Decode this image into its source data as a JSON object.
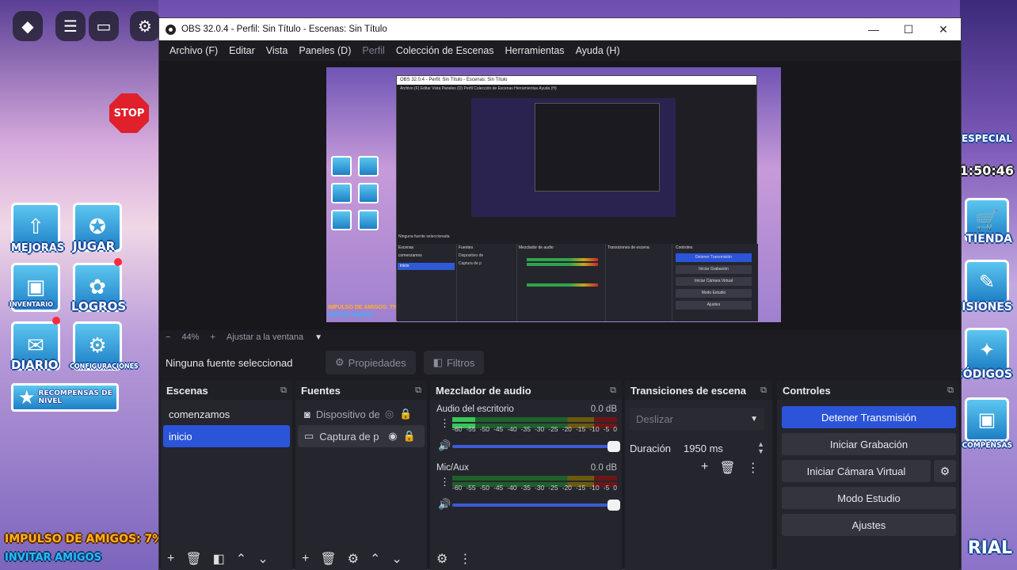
{
  "window": {
    "title": "OBS 32.0.4 - Perfil: Sin Título - Escenas: Sin Título",
    "controls": [
      "—",
      "☐",
      "✕"
    ]
  },
  "menu": [
    {
      "label": "Archivo (F)",
      "enabled": true
    },
    {
      "label": "Editar",
      "enabled": true
    },
    {
      "label": "Vista",
      "enabled": true
    },
    {
      "label": "Paneles (D)",
      "enabled": true
    },
    {
      "label": "Perfil",
      "enabled": false
    },
    {
      "label": "Colección de Escenas",
      "enabled": true
    },
    {
      "label": "Herramientas",
      "enabled": true
    },
    {
      "label": "Ayuda (H)",
      "enabled": true
    }
  ],
  "zoom": {
    "minus": "−",
    "value": "44%",
    "plus": "+",
    "fit": "Ajustar a la ventana",
    "dropdown": "▼"
  },
  "sourcebar": {
    "no_selection": "Ninguna fuente seleccionad",
    "properties": "Propiedades",
    "filters": "Filtros"
  },
  "scenes": {
    "title": "Escenas",
    "items": [
      {
        "label": "comenzamos",
        "selected": false
      },
      {
        "label": "inicio",
        "selected": true
      }
    ]
  },
  "sources": {
    "title": "Fuentes",
    "items": [
      {
        "label": "Dispositivo de",
        "icon": "camera-icon",
        "visible": false
      },
      {
        "label": "Captura de p",
        "icon": "monitor-icon",
        "visible": true
      }
    ]
  },
  "mixer": {
    "title": "Mezclador de audio",
    "channels": [
      {
        "name": "Audio del escritorio",
        "db": "0.0 dB",
        "level": 0.14
      },
      {
        "name": "Mic/Aux",
        "db": "0.0 dB",
        "level": 0.0
      }
    ],
    "ticks": [
      "-60",
      "-55",
      "-50",
      "-45",
      "-40",
      "-35",
      "-30",
      "-25",
      "-20",
      "-15",
      "-10",
      "-5",
      "0"
    ]
  },
  "transitions": {
    "title": "Transiciones de escena",
    "selected": "Deslizar",
    "duration_label": "Duración",
    "duration_value": "1950 ms"
  },
  "controls": {
    "title": "Controles",
    "buttons": {
      "stop_stream": "Detener Transmisión",
      "start_record": "Iniciar Grabación",
      "virtual_cam": "Iniciar Cámara Virtual",
      "studio_mode": "Modo Estudio",
      "settings": "Ajustes"
    }
  },
  "game": {
    "tiles_left": [
      "MEJORAS",
      "JUGAR",
      "INVENTARIO",
      "LOGROS",
      "DIARIO",
      "CONFIGURACIONES"
    ],
    "banner": "RECOMPENSAS DE NIVEL",
    "impulso": "IMPULSO DE AMIGOS: 7%",
    "invitar": "INVITAR AMIGOS",
    "stop": "STOP",
    "right_time": "1:50:46",
    "right_labels": [
      "ESPECIAL",
      "TIENDA",
      "MISIONES",
      "CÓDIGOS",
      "RECOMPENSAS",
      "RIAL"
    ]
  },
  "preview": {
    "title": "OBS 32.0.4 - Perfil: Sin Título - Escenas: Sin Título",
    "menu": "Archivo (F)   Editar   Vista   Paneles (D)   Perfil   Colección de Escenas   Herramientas   Ayuda (H)",
    "no_selection": "Ninguna fuente seleccionada",
    "scenes": "Escenas",
    "sources": "Fuentes",
    "mixer": "Mezclador de audio",
    "transitions": "Transiciones de escena",
    "controls": "Controles",
    "scene_1": "comenzamos",
    "scene_2": "inicio",
    "source_1": "Dispositivo de",
    "source_2": "Captura de p",
    "stop": "Detener Transmisión",
    "record": "Iniciar Grabación",
    "vcam": "Iniciar Cámara Virtual",
    "studio": "Modo Estudio",
    "settings": "Ajustes",
    "impulso": "IMPULSO DE AMIGOS: 7%",
    "invitar": "INVITAR AMIGOS"
  }
}
